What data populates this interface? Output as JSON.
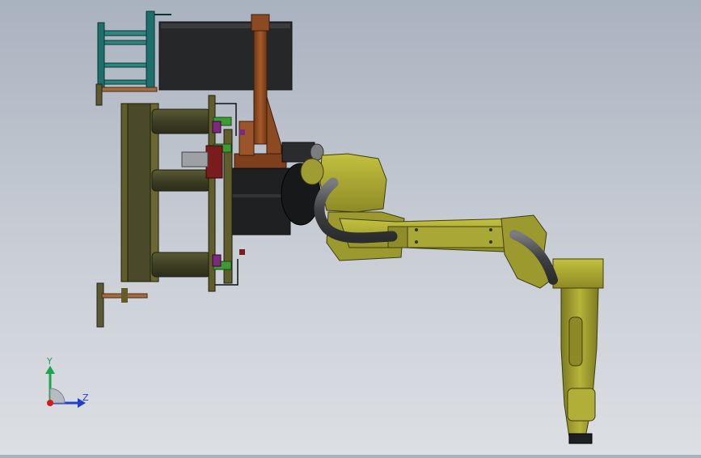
{
  "viewport": {
    "background_top": "#a9b2bf",
    "background_bottom": "#dcdfe3"
  },
  "triad": {
    "y_label": "Y",
    "z_label": "Z",
    "y_color": "#1aa64a",
    "z_color": "#2040c8",
    "x_color": "#d41a1a"
  },
  "model": {
    "robot_color": "#a7a52f",
    "cable_color": "#4d4f53",
    "frame_color": "#5f5d2a",
    "bracket_color": "#1d6f6c",
    "drive_color": "#262729",
    "column_color": "#8b4a22"
  }
}
